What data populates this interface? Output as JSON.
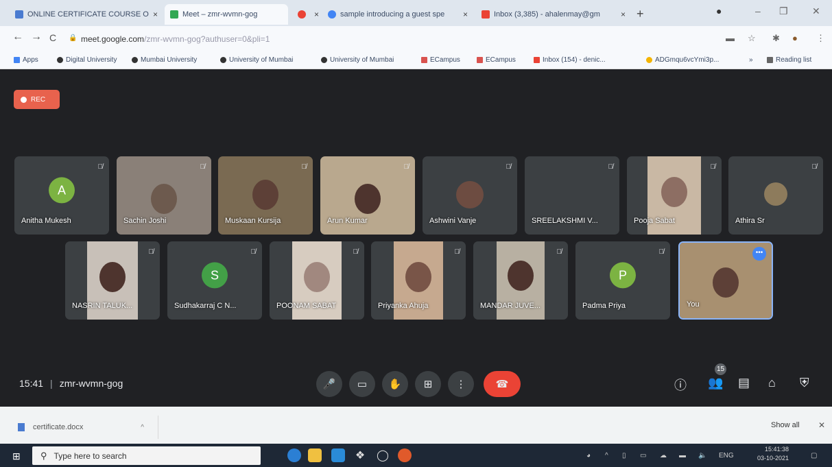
{
  "browser": {
    "tabs": [
      {
        "title": "ONLINE CERTIFICATE COURSE O",
        "color": "#4a7bd0"
      },
      {
        "title": "Meet – zmr-wvmn-gog",
        "color": "#34a853"
      },
      {
        "title": "",
        "color": "#ea4335"
      },
      {
        "title": "sample introducing a guest spe",
        "color": "#4285f4"
      },
      {
        "title": "Inbox (3,385) - ahalenmay@gm",
        "color": "#ea4335"
      }
    ],
    "new_tab": "+",
    "url_host": "meet.google.com",
    "url_path": "/zmr-wvmn-gog?authuser=0&pli=1",
    "bookmarks": [
      {
        "label": "Apps",
        "color": "#4285f4"
      },
      {
        "label": "Digital University",
        "color": "#333333"
      },
      {
        "label": "Mumbai University",
        "color": "#333333"
      },
      {
        "label": "University of Mumbai",
        "color": "#333333"
      },
      {
        "label": "University of Mumbai",
        "color": "#333333"
      },
      {
        "label": "ECampus",
        "color": "#d9534f"
      },
      {
        "label": "ECampus",
        "color": "#d9534f"
      },
      {
        "label": "Inbox (154) - denic...",
        "color": "#ea4335"
      },
      {
        "label": "ADGmqu6vcYmi3p...",
        "color": "#f4b400"
      },
      {
        "label": "»",
        "color": "#f7f9fc"
      },
      {
        "label": "Reading list",
        "color": "#666666"
      }
    ]
  },
  "meet": {
    "rec_label": "REC",
    "row1": [
      {
        "name": "Anitha Mukesh",
        "type": "avatar",
        "letter": "A",
        "color": "#7cb342"
      },
      {
        "name": "Sachin Joshi",
        "type": "video",
        "color": "#8a8078"
      },
      {
        "name": "Muskaan Kursija",
        "type": "video",
        "color": "#7a6a52"
      },
      {
        "name": "Arun Kumar",
        "type": "video",
        "color": "#b9a88e"
      },
      {
        "name": "Ashwini Vanje",
        "type": "small",
        "color": "#6d4c41"
      },
      {
        "name": "SREELAKSHMI V...",
        "type": "blank",
        "color": "#3c4043"
      },
      {
        "name": "Pooja Sabat",
        "type": "video",
        "color": "#c9b8a4"
      },
      {
        "name": "Athira Sr",
        "type": "small",
        "color": "#8d7b5c"
      }
    ],
    "row2": [
      {
        "name": "NASRIN TALUK...",
        "type": "video",
        "color": "#c8c0b8"
      },
      {
        "name": "Sudhakarraj C N...",
        "type": "avatar",
        "letter": "S",
        "color": "#43a047"
      },
      {
        "name": "POONAM SABAT",
        "type": "video",
        "color": "#d7ccc0"
      },
      {
        "name": "Priyanka Ahuja",
        "type": "video",
        "color": "#c6a98f"
      },
      {
        "name": "MANDAR JUVE...",
        "type": "video",
        "color": "#b8b0a2"
      },
      {
        "name": "Padma Priya",
        "type": "avatar",
        "letter": "P",
        "color": "#7cb342"
      },
      {
        "name": "You",
        "type": "video",
        "color": "#a89070"
      }
    ],
    "time": "15:41",
    "meeting_code": "zmr-wvmn-gog",
    "participants_count": "15"
  },
  "download": {
    "file": "certificate.docx",
    "show_all": "Show all"
  },
  "taskbar": {
    "search_placeholder": "Type here to search",
    "lang": "ENG",
    "clock_time": "15:41:38",
    "clock_date": "03-10-2021"
  }
}
